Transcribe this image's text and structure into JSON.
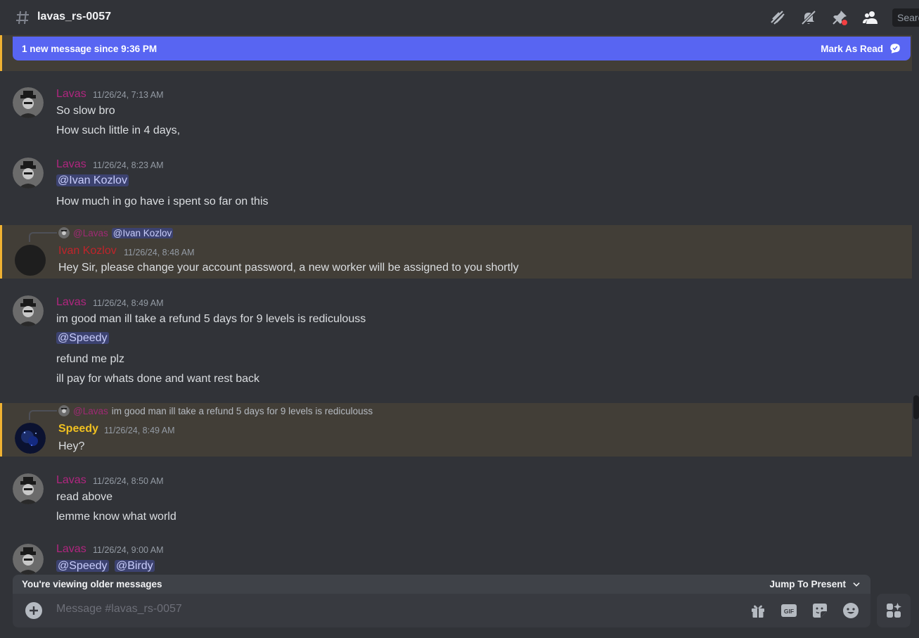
{
  "header": {
    "channel_name": "lavas_rs-0057",
    "search_placeholder": "Search",
    "icons": [
      "threads-icon",
      "mute-icon",
      "pin-icon",
      "members-icon"
    ]
  },
  "banner": {
    "text": "1 new message since 9:36 PM",
    "mark_read": "Mark As Read"
  },
  "messages": [
    {
      "author": "Lavas",
      "timestamp": "11/26/24, 7:13 AM",
      "lines": [
        "So slow bro",
        "How such little in 4 days,"
      ]
    },
    {
      "author": "Lavas",
      "timestamp": "11/26/24, 8:23 AM",
      "mention": "@Ivan Kozlov",
      "lines": [
        "How much in go have i spent so far on this"
      ]
    },
    {
      "author": "Ivan Kozlov",
      "timestamp": "11/26/24, 8:48 AM",
      "reply_to": "@Lavas",
      "reply_text": "@Ivan Kozlov",
      "lines": [
        "Hey Sir, please change your account password, a new worker will be assigned to you shortly"
      ]
    },
    {
      "author": "Lavas",
      "timestamp": "11/26/24, 8:49 AM",
      "lines": [
        "im good man ill take a refund 5 days for 9 levels is rediculouss",
        "@Speedy",
        "refund me plz",
        "ill pay for whats done and want rest back"
      ]
    },
    {
      "author": "Speedy",
      "timestamp": "11/26/24, 8:49 AM",
      "reply_to": "@Lavas",
      "reply_text": "im good man ill take a refund 5 days for 9 levels is rediculouss",
      "lines": [
        "Hey?"
      ]
    },
    {
      "author": "Lavas",
      "timestamp": "11/26/24, 8:50 AM",
      "lines": [
        "read above",
        "lemme know what world"
      ]
    },
    {
      "author": "Lavas",
      "timestamp": "11/26/24, 9:00 AM",
      "mentions": [
        "@Speedy",
        "@Birdy"
      ]
    }
  ],
  "older_bar": {
    "text": "You're viewing older messages",
    "jump": "Jump To Present"
  },
  "composer": {
    "placeholder": "Message #lavas_rs-0057",
    "icons": [
      "gift-icon",
      "gif-icon",
      "sticker-icon",
      "emoji-icon",
      "apps-icon"
    ]
  },
  "colors": {
    "lavas": "#b0267f",
    "ivan": "#c0242a",
    "speedy": "#f0c020",
    "accent": "#5865f2",
    "highlight_border": "#f0b232"
  }
}
